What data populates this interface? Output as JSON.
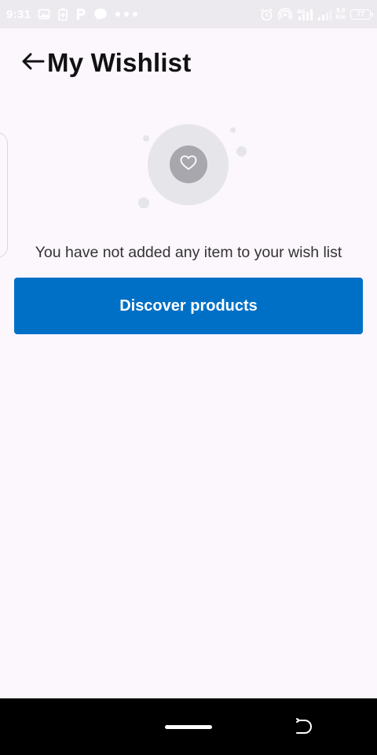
{
  "status_bar": {
    "time": "9:31",
    "net_speed_value": "8.9",
    "net_speed_unit": "K/s",
    "battery": "77",
    "icons": [
      "gallery-icon",
      "battery-saver-icon",
      "parking-p-icon",
      "chat-bubble-icon",
      "more-dots-icon",
      "alarm-icon",
      "hotspot-icon",
      "signal-4g-icon",
      "signal-bars-icon"
    ]
  },
  "header": {
    "title": "My Wishlist",
    "back_icon": "arrow-left-icon"
  },
  "empty_state": {
    "icon": "heart-icon",
    "message": "You have not added any item to your wish list",
    "button_label": "Discover products"
  },
  "colors": {
    "background": "#fcf6fd",
    "primary_button": "#0070c6",
    "status_bar": "#eceaef",
    "nav_bar": "#000000"
  }
}
